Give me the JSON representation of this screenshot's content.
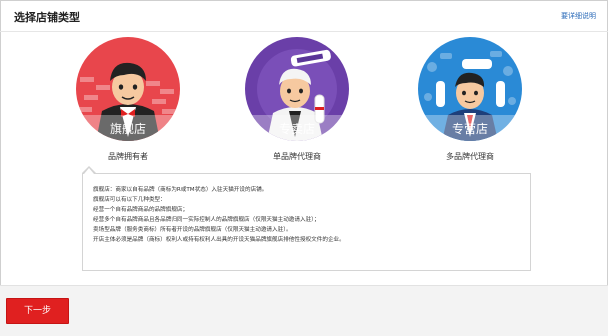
{
  "header": {
    "title": "选择店铺类型",
    "detail_link": "要详细说明"
  },
  "shop_types": [
    {
      "badge": "旗舰店",
      "caption": "品牌拥有者",
      "color": "#e8464c",
      "icon": "businessman-bowtie"
    },
    {
      "badge": "专卖店",
      "caption": "单品牌代理商",
      "color": "#6a3fa8",
      "icon": "businessman-diploma"
    },
    {
      "badge": "专营店",
      "caption": "多品牌代理商",
      "color": "#2a8ad6",
      "icon": "businessman-diploma"
    }
  ],
  "description": {
    "lines": [
      "旗舰店：商家以自有品牌（商标为R或TM状态）入驻天猫开设的店铺。",
      "旗舰店可以有以下几种类型：",
      "经营一个自有品牌商品的品牌旗舰店；",
      "经营多个自有品牌商品且各品牌归同一实际控制人的品牌旗舰店（仅限天猫主动邀请入驻）；",
      "卖场型品牌（服务类商标）所有者开设的品牌旗舰店（仅限天猫主动邀请入驻）。",
      "开店主体必须是品牌（商标）权利人或持有权利人出具的开设天猫品牌旗舰店排他性授权文件的企业。"
    ]
  },
  "footer": {
    "next_label": "下一步"
  }
}
